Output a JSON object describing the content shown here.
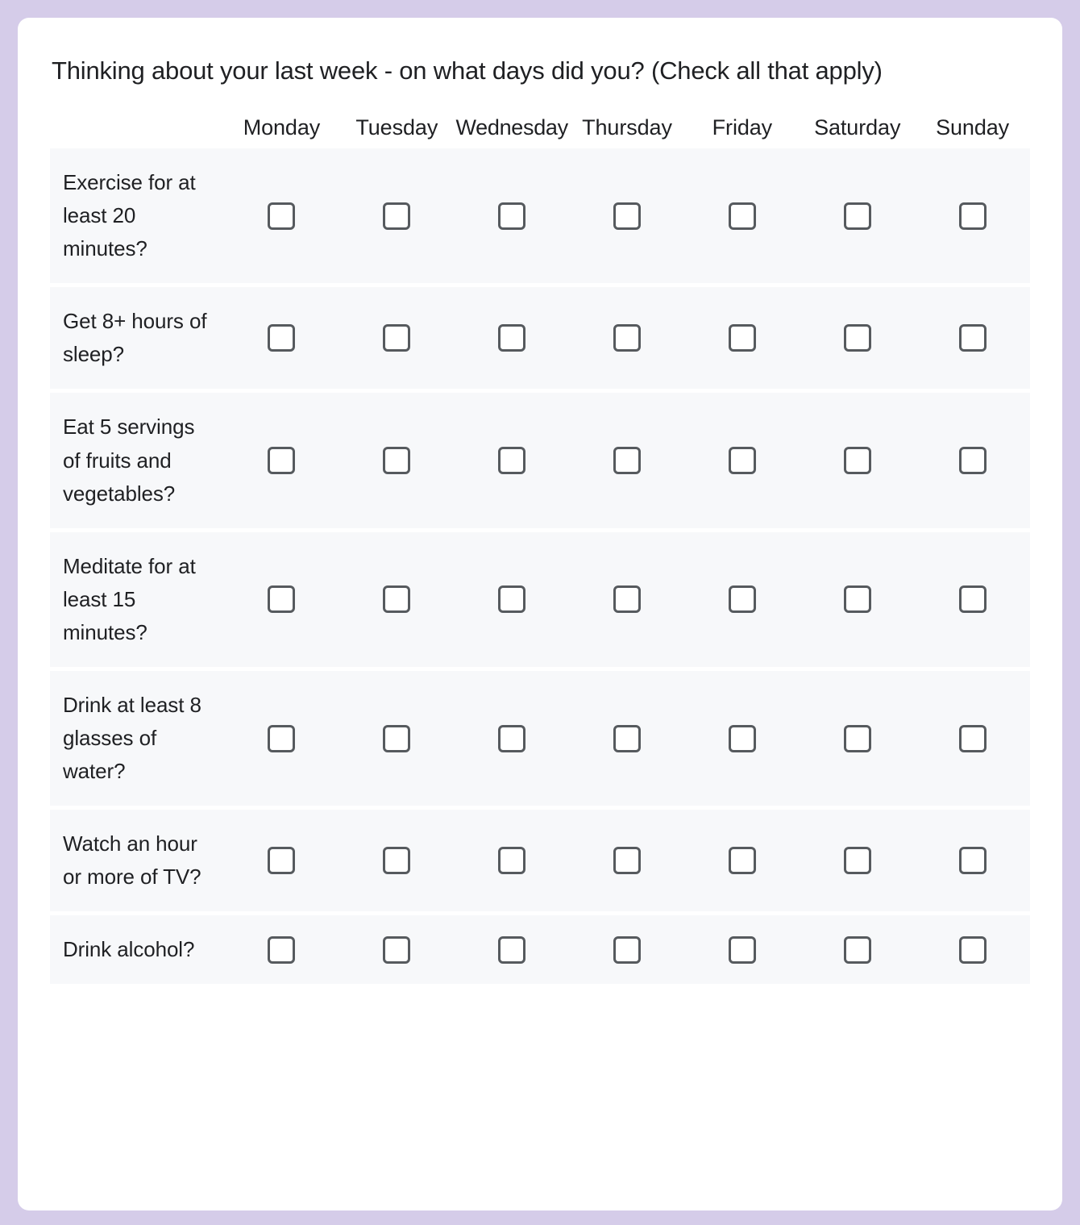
{
  "page": {
    "outer_background": "#d5cce9",
    "card_background": "#ffffff",
    "row_background": "#f7f8fa",
    "text_color": "#1f2023",
    "checkbox_border_color": "#565a5e"
  },
  "survey": {
    "title": "Thinking about your last week - on what days did you? (Check all that apply)",
    "columns": [
      "Monday",
      "Tuesday",
      "Wednesday",
      "Thursday",
      "Friday",
      "Saturday",
      "Sunday"
    ],
    "rows": [
      {
        "label": "Exercise for at least 20 minutes?",
        "checked": [
          false,
          false,
          false,
          false,
          false,
          false,
          false
        ]
      },
      {
        "label": "Get 8+ hours of sleep?",
        "checked": [
          false,
          false,
          false,
          false,
          false,
          false,
          false
        ]
      },
      {
        "label": "Eat 5 servings of fruits and vegetables?",
        "checked": [
          false,
          false,
          false,
          false,
          false,
          false,
          false
        ]
      },
      {
        "label": "Meditate for at least 15 minutes?",
        "checked": [
          false,
          false,
          false,
          false,
          false,
          false,
          false
        ]
      },
      {
        "label": "Drink at least 8 glasses of water?",
        "checked": [
          false,
          false,
          false,
          false,
          false,
          false,
          false
        ]
      },
      {
        "label": "Watch an hour or more of TV?",
        "checked": [
          false,
          false,
          false,
          false,
          false,
          false,
          false
        ]
      },
      {
        "label": "Drink alcohol?",
        "checked": [
          false,
          false,
          false,
          false,
          false,
          false,
          false
        ]
      }
    ]
  }
}
